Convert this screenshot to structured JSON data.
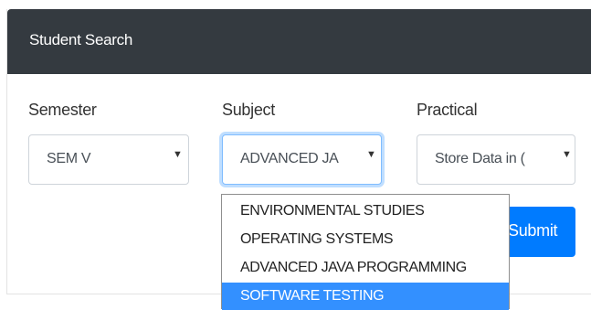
{
  "card": {
    "title": "Student Search"
  },
  "semester": {
    "label": "Semester",
    "value": "SEM V",
    "caret": "▼"
  },
  "subject": {
    "label": "Subject",
    "value": "ADVANCED JA",
    "caret": "▼",
    "options": [
      "ENVIRONMENTAL STUDIES",
      "OPERATING SYSTEMS",
      "ADVANCED JAVA PROGRAMMING",
      "SOFTWARE TESTING"
    ],
    "highlighted_option": "SOFTWARE TESTING"
  },
  "practical": {
    "label": "Practical",
    "value": "Store Data in (",
    "caret": "▼"
  },
  "submit": {
    "label": "Submit"
  },
  "colors": {
    "header_bg": "#343a40",
    "primary": "#007bff",
    "option_highlight": "#3390ff"
  }
}
